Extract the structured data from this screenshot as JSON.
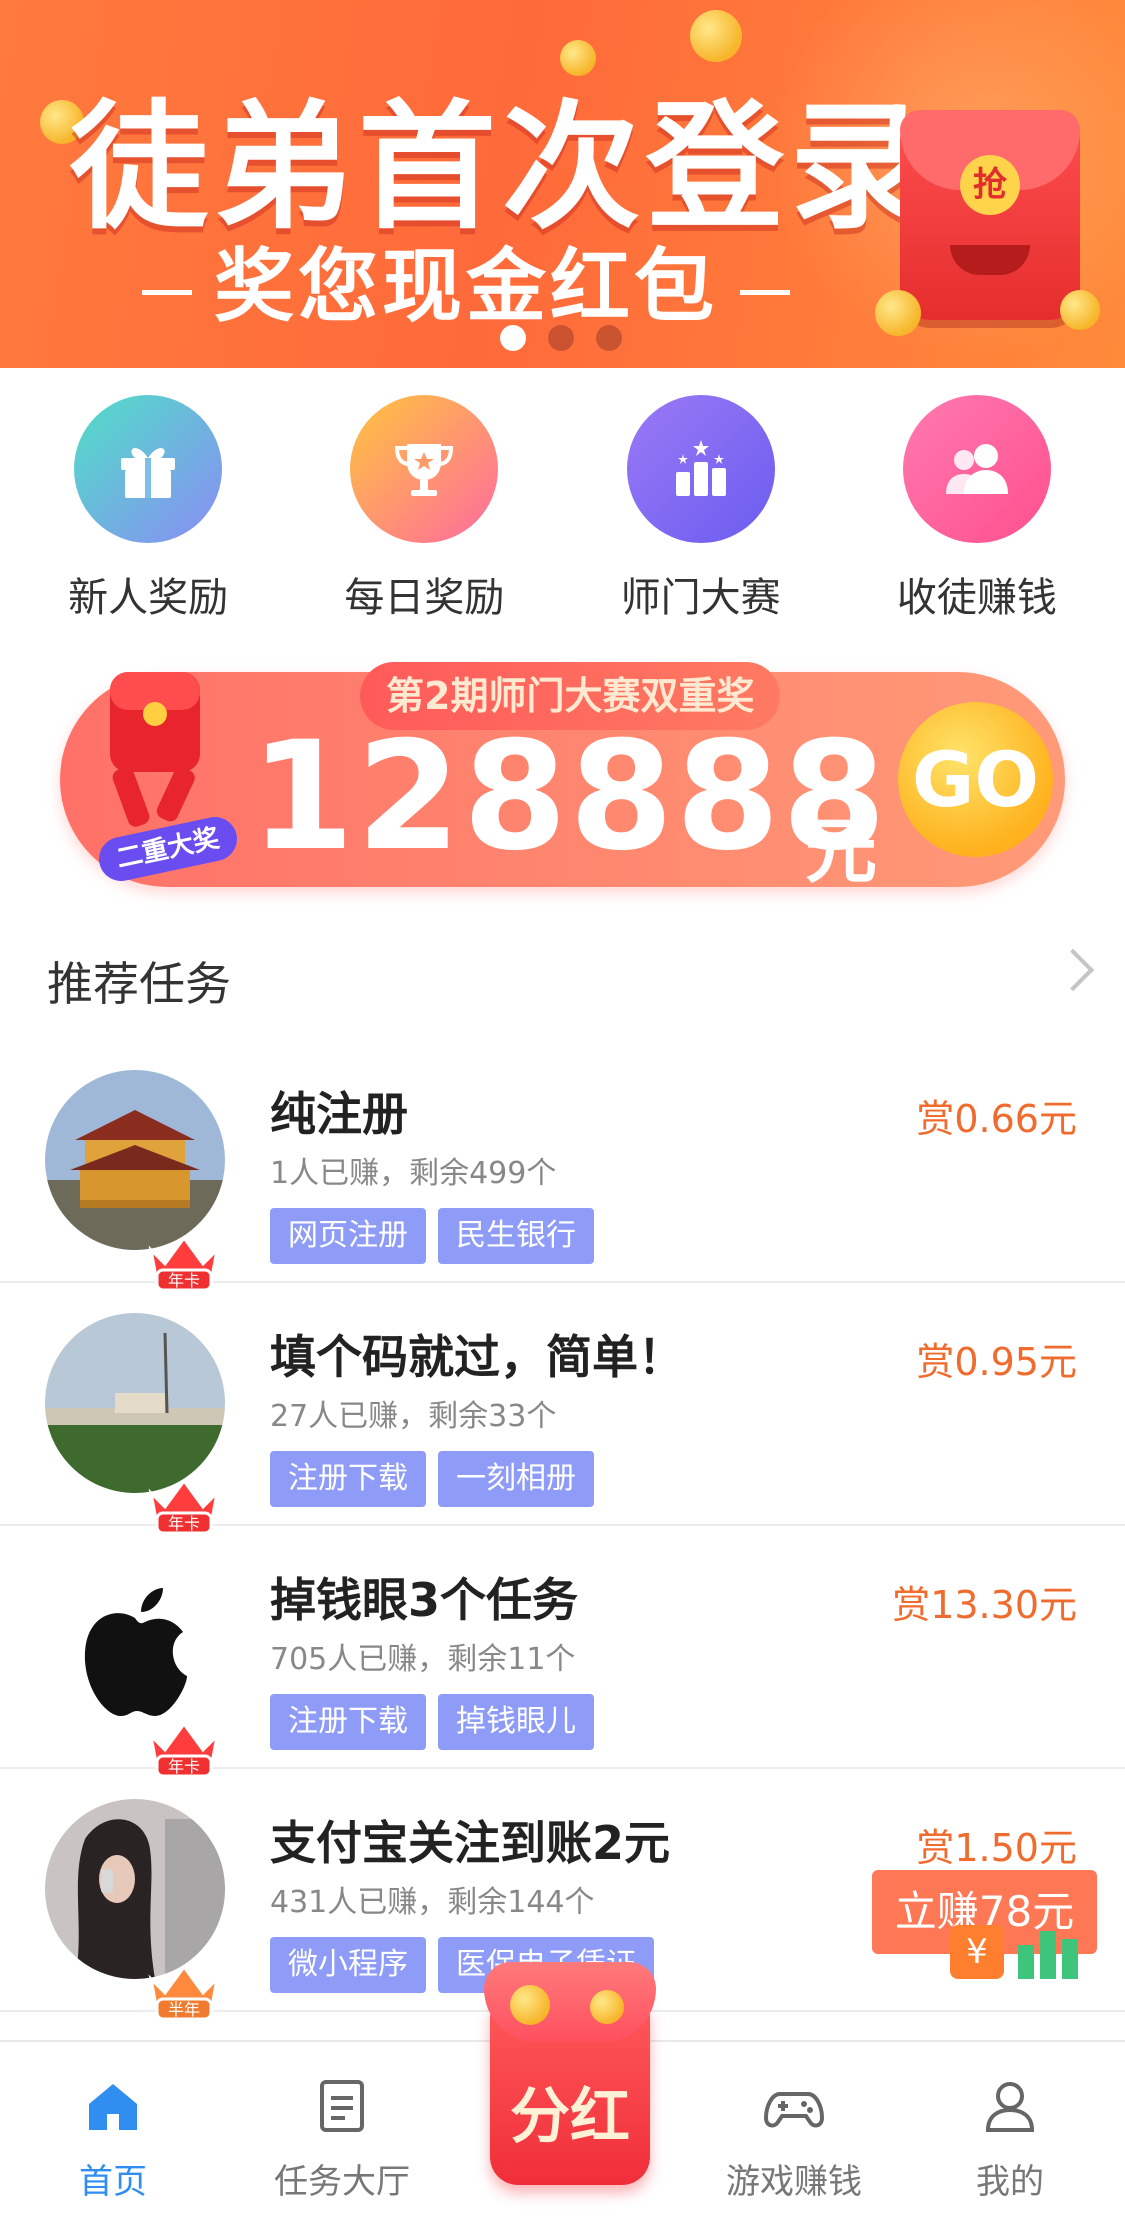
{
  "banner": {
    "title": "徒弟首次登录",
    "subtitle": "奖您现金红包",
    "seal": "抢",
    "coin_symbol": "¥",
    "slides": 3,
    "active_slide": 0
  },
  "quick_actions": [
    {
      "label": "新人奖励",
      "icon": "gift-icon"
    },
    {
      "label": "每日奖励",
      "icon": "trophy-icon"
    },
    {
      "label": "师门大赛",
      "icon": "podium-icon"
    },
    {
      "label": "收徒赚钱",
      "icon": "users-icon"
    }
  ],
  "promo": {
    "tag": "第2期师门大赛双重奖",
    "amount": "128888",
    "unit": "元",
    "go": "GO",
    "badge": "二重大奖",
    "badge_go": "GO"
  },
  "section": {
    "title": "推荐任务"
  },
  "tasks": [
    {
      "title": "纯注册",
      "meta": "1人已赚，剩余499个",
      "tags": [
        "网页注册",
        "民生银行"
      ],
      "reward": "赏0.66元",
      "badge": "年卡"
    },
    {
      "title": "填个码就过，简单！",
      "meta": "27人已赚，剩余33个",
      "tags": [
        "注册下载",
        "一刻相册"
      ],
      "reward": "赏0.95元",
      "badge": "年卡"
    },
    {
      "title": "掉钱眼3个任务",
      "meta": "705人已赚，剩余11个",
      "tags": [
        "注册下载",
        "掉钱眼儿"
      ],
      "reward": "赏13.30元",
      "badge": "年卡"
    },
    {
      "title": "支付宝关注到账2元",
      "meta": "431人已赚，剩余144个",
      "tags": [
        "微小程序",
        "医保电子凭证"
      ],
      "reward": "赏1.50元",
      "badge": "半年"
    }
  ],
  "floating": {
    "earn": "立赚78元",
    "yen": "¥"
  },
  "bottom_nav": {
    "home": "首页",
    "tasks": "任务大厅",
    "center": "分红",
    "games": "游戏赚钱",
    "mine": "我的"
  },
  "colors": {
    "accent": "#2f8ef0",
    "reward": "#f06b2e",
    "tag": "#8f9cf7",
    "banner": "#ff6a3a"
  }
}
